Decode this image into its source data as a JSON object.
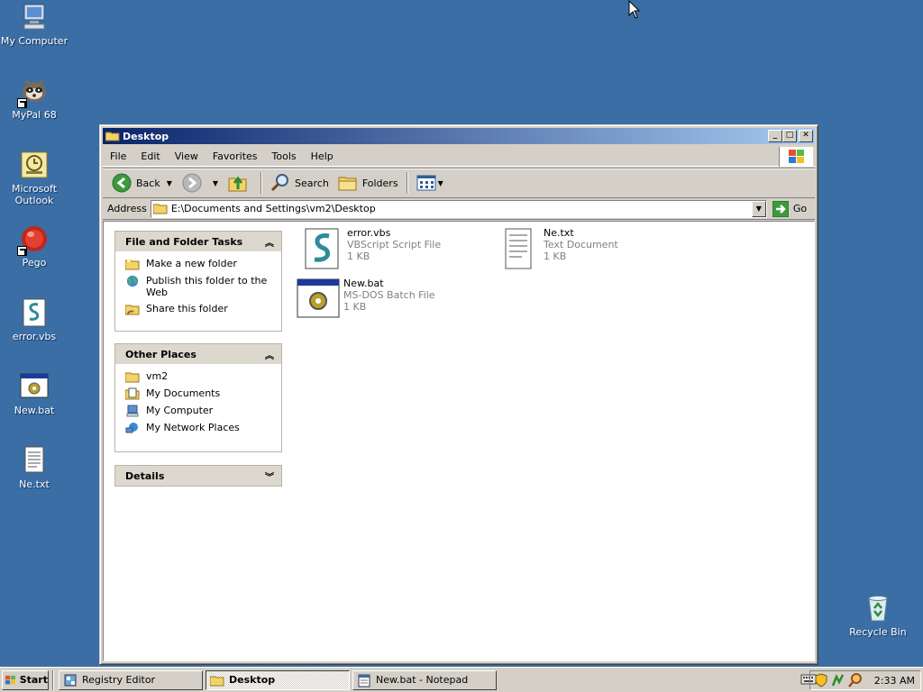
{
  "desktop": {
    "icons": [
      {
        "label": "My Computer",
        "icon": "computer-icon"
      },
      {
        "label": "MyPal 68",
        "icon": "raccoon-icon"
      },
      {
        "label": "Microsoft Outlook",
        "icon": "outlook-icon"
      },
      {
        "label": "Pego",
        "icon": "pego-icon"
      },
      {
        "label": "error.vbs",
        "icon": "vbscript-icon"
      },
      {
        "label": "New.bat",
        "icon": "batch-icon"
      },
      {
        "label": "Ne.txt",
        "icon": "text-file-icon"
      },
      {
        "label": "Recycle Bin",
        "icon": "recycle-bin-icon"
      }
    ],
    "background_color": "#3a6ea5"
  },
  "window": {
    "title": "Desktop",
    "menu": [
      "File",
      "Edit",
      "View",
      "Favorites",
      "Tools",
      "Help"
    ],
    "toolbar": {
      "back_label": "Back",
      "search_label": "Search",
      "folders_label": "Folders"
    },
    "address": {
      "label": "Address",
      "value": "E:\\Documents and Settings\\vm2\\Desktop",
      "go_label": "Go"
    },
    "tasks_panel": {
      "title": "File and Folder Tasks",
      "links": [
        "Make a new folder",
        "Publish this folder to the Web",
        "Share this folder"
      ]
    },
    "places_panel": {
      "title": "Other Places",
      "links": [
        "vm2",
        "My Documents",
        "My Computer",
        "My Network Places"
      ]
    },
    "details_panel": {
      "title": "Details"
    },
    "files": [
      {
        "name": "error.vbs",
        "type": "VBScript Script File",
        "size": "1 KB",
        "icon": "vbscript-icon"
      },
      {
        "name": "Ne.txt",
        "type": "Text Document",
        "size": "1 KB",
        "icon": "text-file-icon"
      },
      {
        "name": "New.bat",
        "type": "MS-DOS Batch File",
        "size": "1 KB",
        "icon": "batch-icon"
      }
    ]
  },
  "taskbar": {
    "start_label": "Start",
    "tasks": [
      {
        "label": "Registry Editor",
        "active": false
      },
      {
        "label": "Desktop",
        "active": true
      },
      {
        "label": "New.bat - Notepad",
        "active": false
      }
    ],
    "clock": "2:33 AM"
  }
}
